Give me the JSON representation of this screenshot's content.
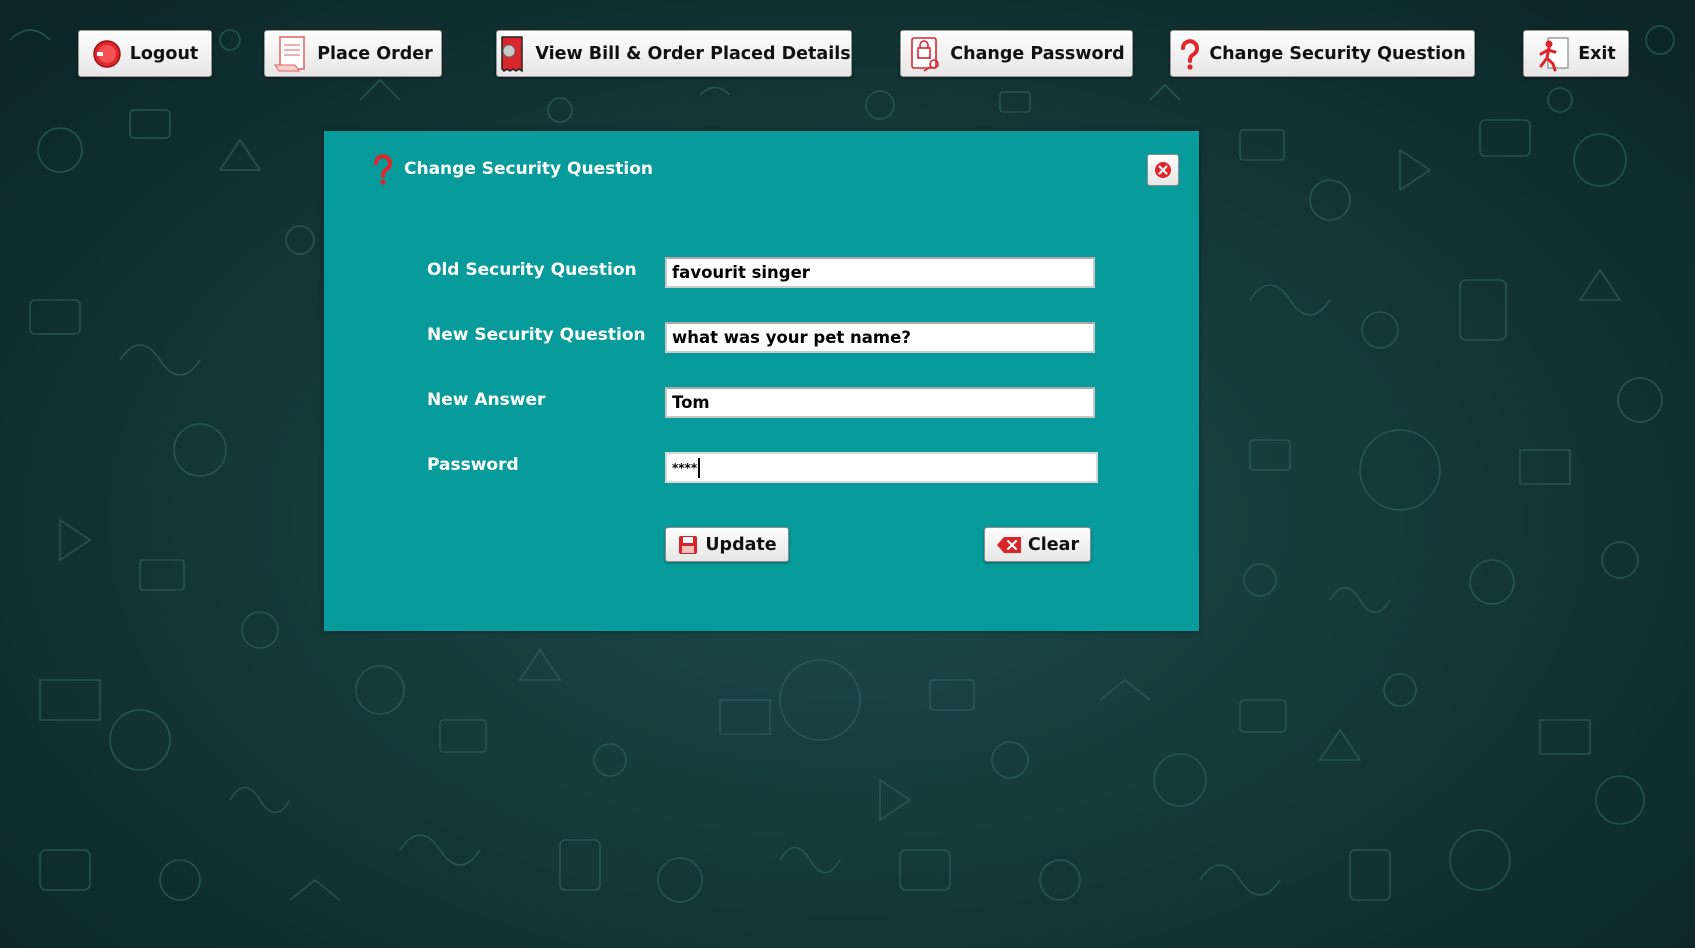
{
  "toolbar": {
    "logout_label": "Logout",
    "place_order_label": "Place Order",
    "view_bill_label": "View Bill & Order Placed Details",
    "change_password_label": "Change Password",
    "change_security_question_label": "Change Security Question",
    "exit_label": "Exit"
  },
  "dialog": {
    "title": "Change Security Question",
    "fields": {
      "old_question": {
        "label": "Old Security Question",
        "value": "favourit singer"
      },
      "new_question": {
        "label": "New Security Question",
        "value": "what was your pet name?"
      },
      "new_answer": {
        "label": "New Answer",
        "value": "Tom"
      },
      "password": {
        "label": "Password",
        "value": "****"
      }
    },
    "update_label": "Update",
    "clear_label": "Clear"
  },
  "colors": {
    "dialog_background": "#089b9b",
    "page_background": "#153a3a",
    "icon_red": "#e0262c"
  },
  "icons": {
    "logout": "power-icon",
    "place_order": "document-icon",
    "view_bill": "bill-icon",
    "change_password": "lock-key-icon",
    "change_security_question": "question-mark-icon",
    "exit": "running-man-icon",
    "close": "close-icon",
    "update": "save-icon",
    "clear": "backspace-icon"
  }
}
